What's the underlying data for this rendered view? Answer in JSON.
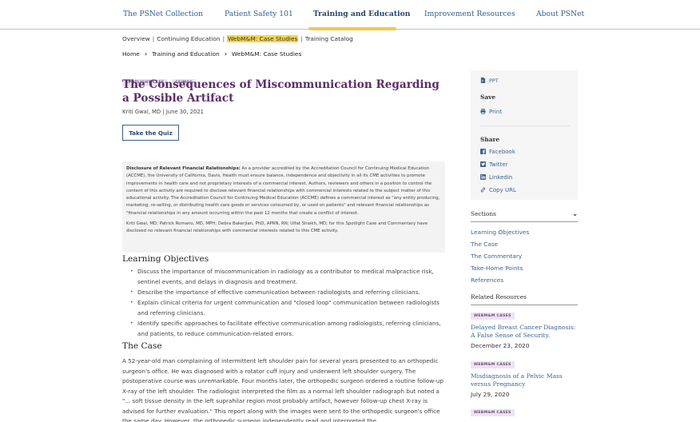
{
  "topnav": {
    "items": [
      {
        "label": "The PSNet Collection",
        "active": false
      },
      {
        "label": "Patient Safety 101",
        "active": false
      },
      {
        "label": "Training and Education",
        "active": true
      },
      {
        "label": "Improvement Resources",
        "active": false
      },
      {
        "label": "About PSNet",
        "active": false
      }
    ],
    "accent_color": "#f2c94c"
  },
  "subnav": {
    "items": [
      "Overview",
      "Continuing Education",
      "WebM&M: Case Studies",
      "Training Catalog"
    ],
    "active_index": 2
  },
  "breadcrumb": [
    "Home",
    "Training and Education",
    "WebM&M: Case Studies"
  ],
  "article": {
    "tags": [
      "SPOTLIGHT CASE",
      "CE/MOC"
    ],
    "title": "The Consequences of Miscommunication Regarding a Possible Artifact",
    "byline": "Kriti Gwal, MD | June 30, 2021",
    "quiz_button": "Take the Quiz",
    "disclosure": {
      "label": "Disclosure of Relevant Financial Relationships:",
      "text": " As a provider accredited by the Accreditation Council for Continuing Medical Education (ACCME), the University of California, Davis, Health must ensure balance, independence and objectivity in all its CME activities to promote improvements in health care and not proprietary interests of a commercial interest.  Authors, reviewers and others in a position to control the content of this activity are required to disclose relevant financial relationships with commercial interests related to the subject matter of this educational activity.  The Accreditation Council for Continuing Medical Education (ACCME) defines a commercial interest as \"any entity producing, marketing, re-selling, or distributing health care goods or services consumed by, or used on patients\" and relevant financial relationships as \"financial relationships in any amount occurring within the past 12 months that create a conflict of interest.",
      "authors_statement": "Kriti Gwal, MD; Patrick Romano, MD, MPH; Debra Bakerjian, PhD, APRN, RN; Ulfat Shaikh, MD; for this Spotlight Case and Commentary have disclosed no relevant financial relationships with commercial interests related to this CME activity."
    },
    "learning_objectives": {
      "heading": "Learning Objectives",
      "items": [
        "Discuss the importance of miscommunication in radiology as a contributor to medical malpractice risk, sentinel events, and delays in diagnosis and treatment.",
        "Describe the importance of effective communication between radiologists and referring clinicians.",
        "Explain clinical criteria for urgent communication and \"closed loop\" communication between radiologists and referring clinicians.",
        "Identify specific approaches to facilitate effective communication among radiologists, referring clinicians, and patients, to reduce communication-related errors."
      ]
    },
    "the_case": {
      "heading": "The Case",
      "text": "A 52-year-old man complaining of intermittent left shoulder pain for several years presented to an orthopedic surgeon's office. He was diagnosed with a rotator cuff injury and underwent left shoulder surgery. The postoperative course was unremarkable. Four months later, the orthopedic surgeon ordered a routine follow-up X-ray of the left shoulder. The radiologist interpreted the film as a normal left shoulder radiograph but noted a \"... soft tissue density in the left suprahilar region most probably artifact, however follow-up chest X-ray is advised for further evaluation.\" This report along with the images were sent to the orthopedic surgeon's office the same day. However, the orthopedic surgeon independently read and interpreted the"
    }
  },
  "sidebar": {
    "ppt_label": "PPT",
    "save_heading": "Save",
    "print_label": "Print",
    "share_heading": "Share",
    "share_items": [
      {
        "label": "Facebook",
        "icon": "facebook-icon"
      },
      {
        "label": "Twitter",
        "icon": "twitter-icon"
      },
      {
        "label": "Linkedin",
        "icon": "linkedin-icon"
      },
      {
        "label": "Copy URL",
        "icon": "link-icon"
      }
    ],
    "sections_heading": "Sections",
    "sections": [
      "Learning Objectives",
      "The Case",
      "The Commentary",
      "Take-Home Points",
      "References"
    ],
    "related_heading": "Related Resources",
    "related": [
      {
        "tag": "WEBM&M CASES",
        "title": "Delayed Breast Cancer Diagnosis: A False Sense of Security.",
        "date": "December 23, 2020"
      },
      {
        "tag": "WEBM&M CASES",
        "title": "Misdiagnosis of a Pelvic Mass versus Pregnancy",
        "date": "July 29, 2020"
      },
      {
        "tag": "WEBM&M CASES",
        "title": "",
        "date": ""
      }
    ]
  }
}
